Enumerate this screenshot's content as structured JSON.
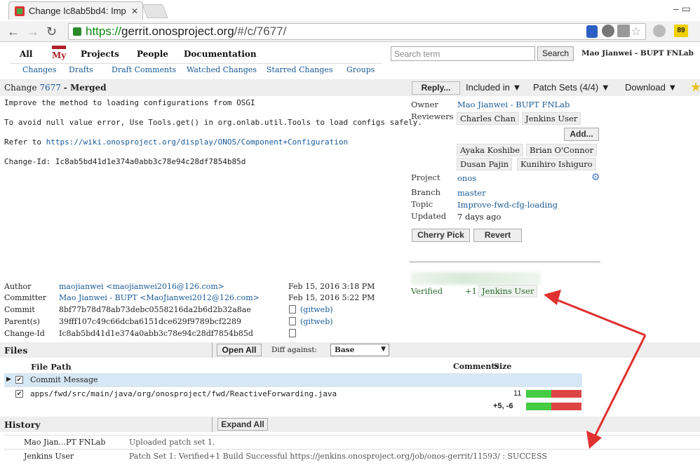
{
  "browser": {
    "tab_title": "Change Ic8ab5bd4: Imp",
    "url_scheme": "https://",
    "url_host": "gerrit.onosproject.org",
    "url_path": "/#/c/7677/",
    "ext_badge": "89"
  },
  "topmenu": {
    "items": [
      "All",
      "My",
      "Projects",
      "People",
      "Documentation"
    ],
    "subitems": [
      "Changes",
      "Drafts",
      "Draft Comments",
      "Watched Changes",
      "Starred Changes",
      "Groups"
    ],
    "search_placeholder": "Search term",
    "search_button": "Search",
    "user": "Mao Jianwei - BUPT FNLab"
  },
  "change": {
    "label": "Change",
    "number": "7677",
    "status": "- Merged",
    "buttons": {
      "reply": "Reply...",
      "included_in": "Included in ▼",
      "patch_sets": "Patch Sets (4/4) ▼",
      "download": "Download ▼"
    },
    "message": {
      "line1": "Improve the method to loading configurations from OSGI",
      "line2": "To avoid null value error, Use Tools.get() in org.onlab.util.Tools to load configs safely.",
      "refer_prefix": "Refer to ",
      "refer_link": "https://wiki.onosproject.org/display/ONOS/Component+Configuration",
      "change_id": "Change-Id: Ic8ab5bd41d1e374a0abb3c78e94c28df7854b85d"
    }
  },
  "info": {
    "owner_label": "Owner",
    "owner": "Mao Jianwei - BUPT FNLab",
    "reviewers_label": "Reviewers",
    "reviewers": [
      "Charles Chan",
      "Jenkins User"
    ],
    "add_button": "Add...",
    "suggested": [
      "Ayaka Koshibe",
      "Brian O'Connor",
      "Dusan Pajin",
      "Kunihiro Ishiguro"
    ],
    "project_label": "Project",
    "project": "onos",
    "branch_label": "Branch",
    "branch": "master",
    "topic_label": "Topic",
    "topic": "Improve-fwd-cfg-loading",
    "updated_label": "Updated",
    "updated": "7 days ago",
    "cherry_pick": "Cherry Pick",
    "revert": "Revert",
    "verified_label": "Verified",
    "verified_score": "+1",
    "verified_by": "Jenkins User"
  },
  "commit": {
    "author_label": "Author",
    "author": "maojianwei <maojianwei2016@126.com>",
    "author_date": "Feb 15, 2016 3:18 PM",
    "committer_label": "Committer",
    "committer": "Mao Jianwei - BUPT <MaoJianwei2012@126.com>",
    "committer_date": "Feb 15, 2016 5:22 PM",
    "commit_label": "Commit",
    "commit": "8bf77b78d78ab73debc0558216da2b6d2b32a8ae",
    "gitweb": "(gitweb)",
    "parent_label": "Parent(s)",
    "parent": "39fff107c49c66dcba6151dce629f9789bcf2289",
    "changeid_label": "Change-Id",
    "changeid": "Ic8ab5bd41d1e374a0abb3c78e94c28df7854b85d"
  },
  "files": {
    "title": "Files",
    "open_all": "Open All",
    "diff_label": "Diff against:",
    "diff_value": "Base",
    "col_path": "File Path",
    "col_comments": "Comments",
    "col_size": "Size",
    "rows": [
      {
        "path": "Commit Message",
        "size": ""
      },
      {
        "path": "apps/fwd/src/main/java/org/onosproject/fwd/ReactiveForwarding.java",
        "size": "11"
      }
    ],
    "total": "+5, -6"
  },
  "history": {
    "title": "History",
    "expand_all": "Expand All",
    "rows": [
      {
        "who": "Mao Jian...PT FNLab",
        "text": "Uploaded patch set 1."
      },
      {
        "who": "Jenkins User",
        "text": "Patch Set 1: Verified+1 Build Successful https://jenkins.onosproject.org/job/onos-gerrit/11593/ : SUCCESS"
      }
    ]
  },
  "colors": {
    "accent_red": "#b0202a",
    "link_blue": "#1a5a96",
    "verified_green": "#2a6a2a",
    "size_green": "#44cc44",
    "size_red": "#dd4444",
    "arrow": "#e03030"
  }
}
